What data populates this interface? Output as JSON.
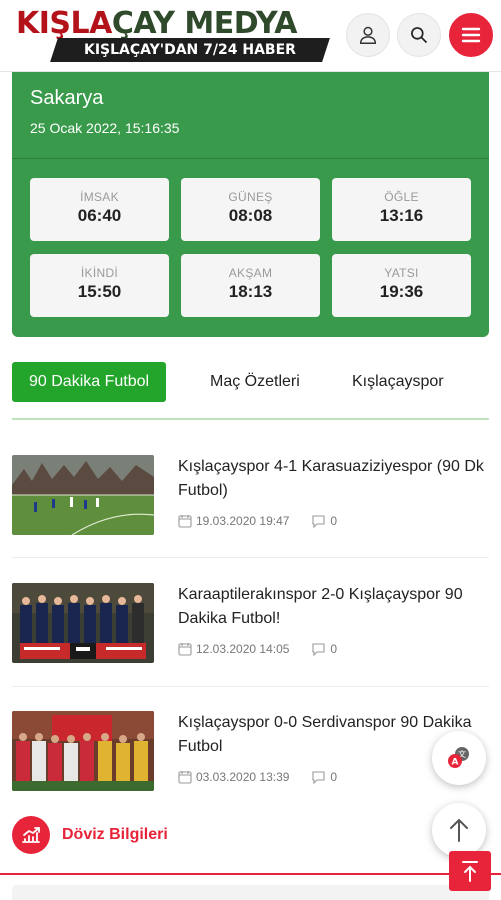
{
  "header": {
    "logo_part1": "KIŞLA",
    "logo_part2": "ÇAY MEDYA",
    "logo_tagline": "KIŞLAÇAY'DAN 7/24 HABER",
    "icons": {
      "user": "user-icon",
      "search": "search-icon",
      "menu": "hamburger-menu-icon"
    }
  },
  "prayer": {
    "city": "Sakarya",
    "datetime": "25 Ocak 2022, 15:16:35",
    "times": [
      {
        "label": "İMSAK",
        "time": "06:40"
      },
      {
        "label": "GÜNEŞ",
        "time": "08:08"
      },
      {
        "label": "ÖĞLE",
        "time": "13:16"
      },
      {
        "label": "İKİNDİ",
        "time": "15:50"
      },
      {
        "label": "AKŞAM",
        "time": "18:13"
      },
      {
        "label": "YATSI",
        "time": "19:36"
      }
    ]
  },
  "tabs": [
    "90 Dakika Futbol",
    "Maç Özetleri",
    "Kışlaçayspor"
  ],
  "news": [
    {
      "title": "Kışlaçayspor 4-1 Karasuaziziyespor (90 Dk Futbol)",
      "date": "19.03.2020 19:47",
      "comments": "0"
    },
    {
      "title": "Karaaptilerakınspor 2-0 Kışlaçayspor 90 Dakika Futbol!",
      "date": "12.03.2020 14:05",
      "comments": "0"
    },
    {
      "title": "Kışlaçayspor 0-0 Serdivanspor 90 Dakika Futbol",
      "date": "03.03.2020 13:39",
      "comments": "0"
    }
  ],
  "footer": {
    "doviz_label": "Döviz Bilgileri"
  },
  "colors": {
    "brand_red": "#e8243a",
    "prayer_green": "#3a9a4c",
    "tab_green": "#23a42a"
  }
}
